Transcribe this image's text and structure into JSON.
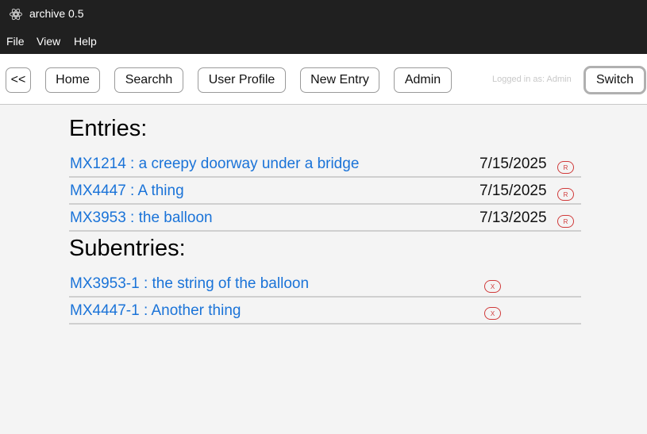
{
  "window": {
    "title": "archive 0.5"
  },
  "menu": {
    "file": "File",
    "view": "View",
    "help": "Help"
  },
  "nav": {
    "back": "<<",
    "home": "Home",
    "search": "Searchh",
    "profile": "User Profile",
    "new_entry": "New Entry",
    "admin": "Admin",
    "logged_in": "Logged in as: Admin",
    "switch": "Switch"
  },
  "entries": {
    "heading": "Entries:",
    "items": [
      {
        "label": "MX1214 : a creepy doorway under a bridge",
        "date": "7/15/2025",
        "badge": "R"
      },
      {
        "label": "MX4447 : A thing",
        "date": "7/15/2025",
        "badge": "R"
      },
      {
        "label": "MX3953 : the balloon",
        "date": "7/13/2025",
        "badge": "R"
      }
    ]
  },
  "subentries": {
    "heading": "Subentries:",
    "items": [
      {
        "label": "MX3953-1 : the string of the balloon",
        "badge": "X"
      },
      {
        "label": "MX4447-1 : Another thing",
        "badge": "X"
      }
    ]
  }
}
